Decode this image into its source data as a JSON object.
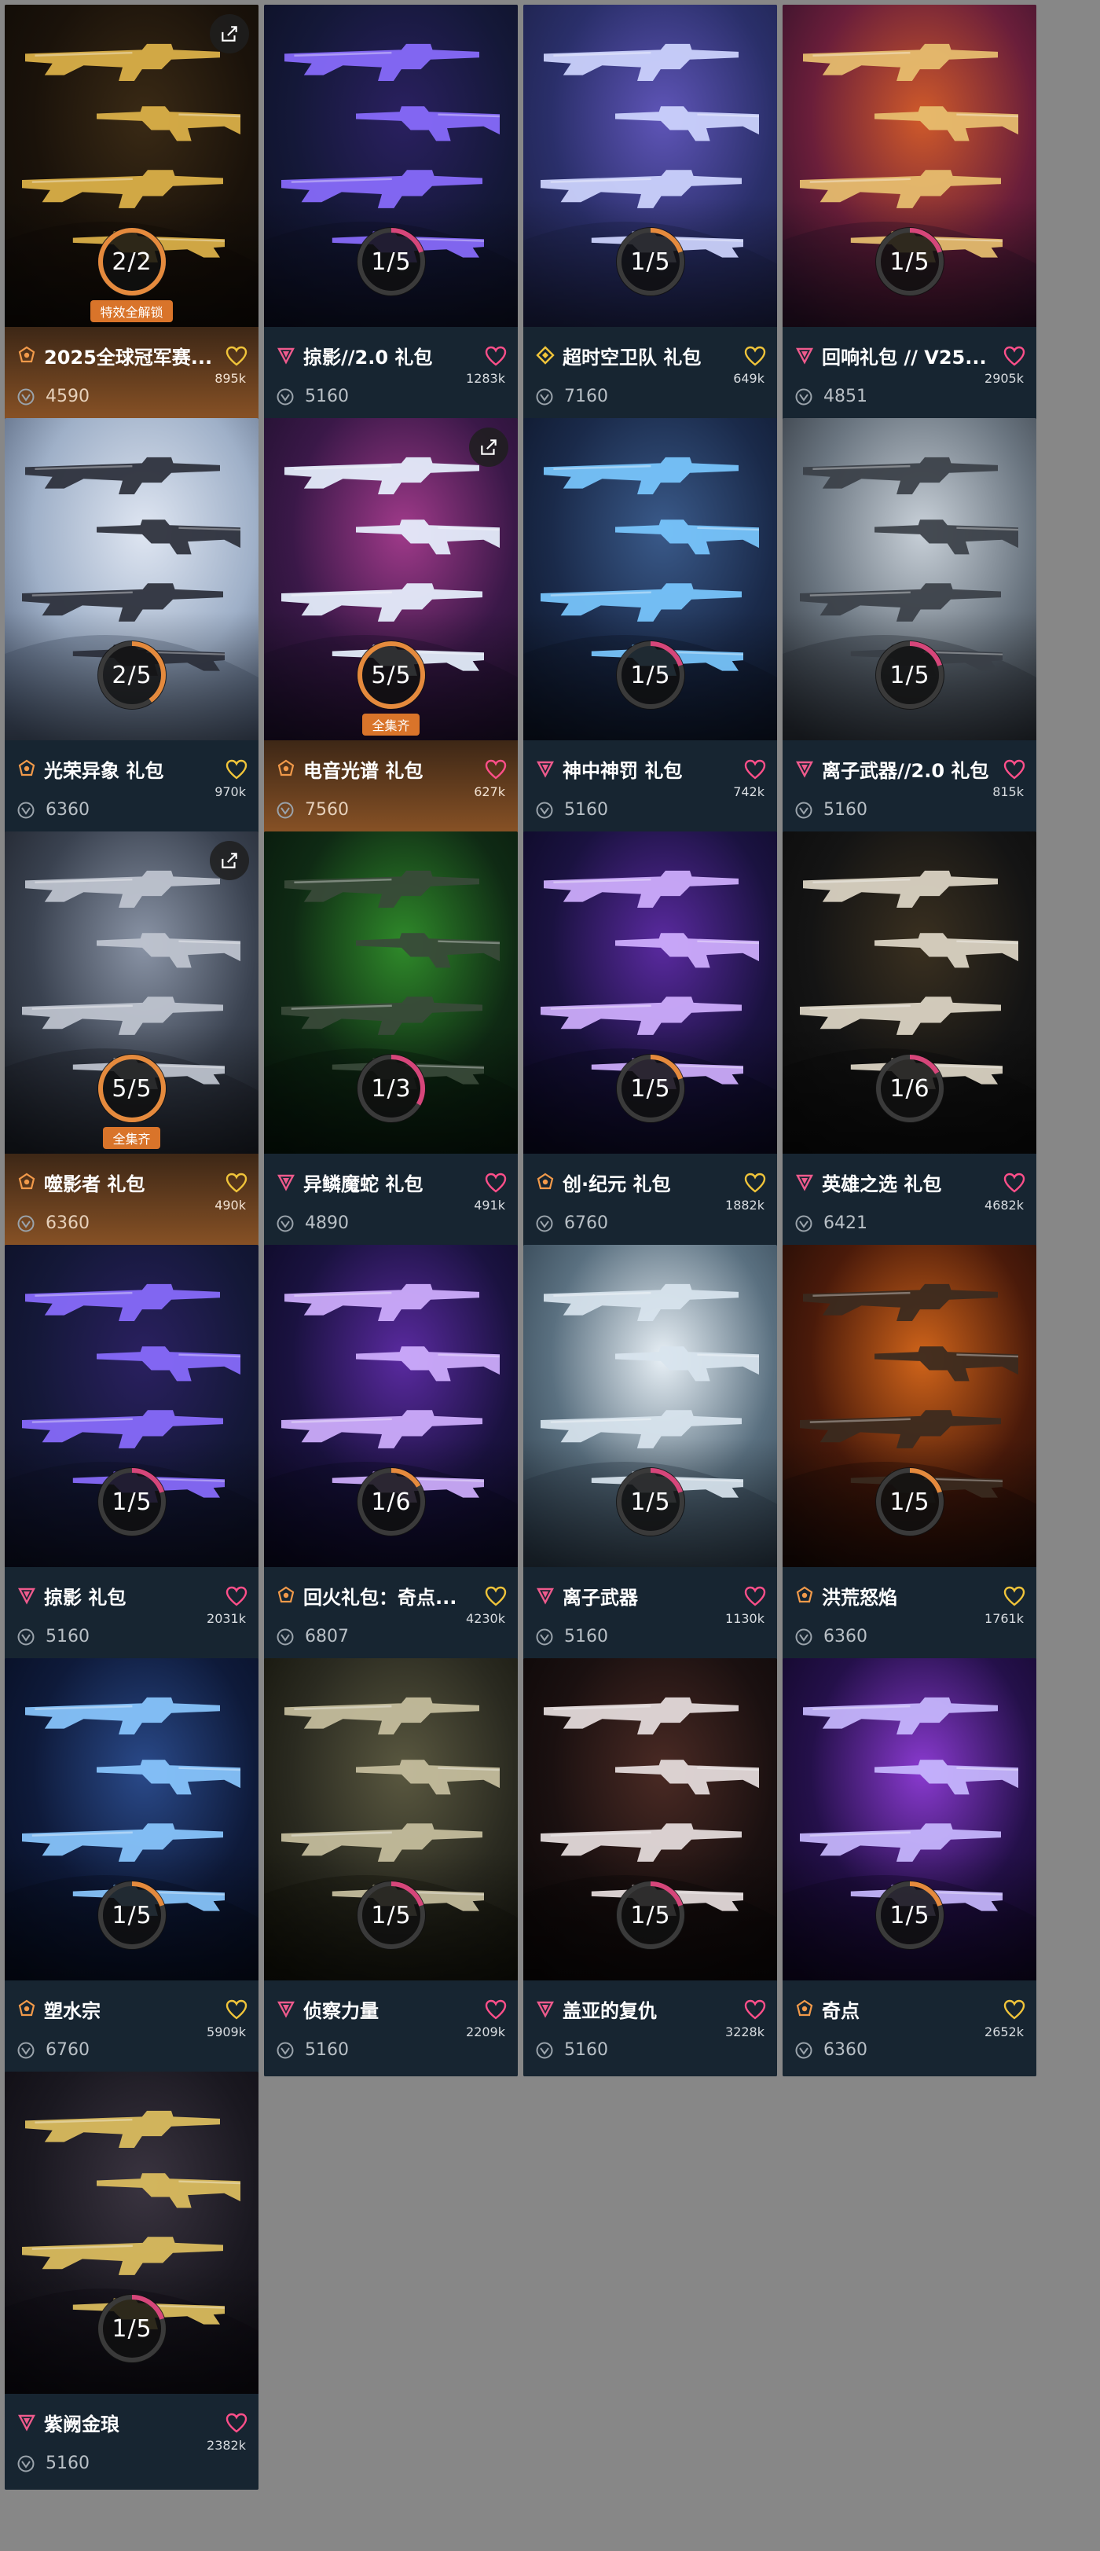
{
  "colors": {
    "page_bg": "#878787",
    "card_bg": "#172531",
    "gold_footer": "#8a5326",
    "ring_track": "#3a3a3a",
    "ring_orange": "#e58a3d",
    "ring_pink": "#d6467a",
    "heart_pink": "#ff4f8a",
    "heart_gold": "#f0c43a"
  },
  "cards": [
    {
      "name": "2025全球冠军赛...",
      "price": "4590",
      "likes": "895k",
      "progress": "2/2",
      "have": 2,
      "total": 2,
      "tier": "ultra",
      "style": "gold",
      "badge": "特效全解锁",
      "share": true,
      "theme": "gold",
      "heart": "gold"
    },
    {
      "name": "掠影//2.0 礼包",
      "price": "5160",
      "likes": "1283k",
      "progress": "1/5",
      "have": 1,
      "total": 5,
      "tier": "exclusive",
      "style": "plain",
      "badge": "",
      "share": false,
      "theme": "violet",
      "heart": "pink"
    },
    {
      "name": "超时空卫队 礼包",
      "price": "7160",
      "likes": "649k",
      "progress": "1/5",
      "have": 1,
      "total": 5,
      "tier": "premium",
      "style": "plain",
      "badge": "",
      "share": false,
      "theme": "space",
      "heart": "gold"
    },
    {
      "name": "回响礼包 // V25...",
      "price": "4851",
      "likes": "2905k",
      "progress": "1/5",
      "have": 1,
      "total": 5,
      "tier": "exclusive",
      "style": "plain",
      "badge": "",
      "share": false,
      "theme": "sunset",
      "heart": "pink"
    },
    {
      "name": "光荣异象 礼包",
      "price": "6360",
      "likes": "970k",
      "progress": "2/5",
      "have": 2,
      "total": 5,
      "tier": "ultra",
      "style": "plain",
      "badge": "",
      "share": false,
      "theme": "ice",
      "heart": "gold"
    },
    {
      "name": "电音光谱 礼包",
      "price": "7560",
      "likes": "627k",
      "progress": "5/5",
      "have": 5,
      "total": 5,
      "tier": "ultra",
      "style": "gold",
      "badge": "全集齐",
      "share": true,
      "theme": "neon",
      "heart": "pink"
    },
    {
      "name": "神中神罚 礼包",
      "price": "5160",
      "likes": "742k",
      "progress": "1/5",
      "have": 1,
      "total": 5,
      "tier": "exclusive",
      "style": "plain",
      "badge": "",
      "share": false,
      "theme": "storm",
      "heart": "pink"
    },
    {
      "name": "离子武器//2.0 礼包",
      "price": "5160",
      "likes": "815k",
      "progress": "1/5",
      "have": 1,
      "total": 5,
      "tier": "exclusive",
      "style": "plain",
      "badge": "",
      "share": false,
      "theme": "silver",
      "heart": "pink"
    },
    {
      "name": "噬影者 礼包",
      "price": "6360",
      "likes": "490k",
      "progress": "5/5",
      "have": 5,
      "total": 5,
      "tier": "ultra",
      "style": "gold",
      "badge": "全集齐",
      "share": true,
      "theme": "grey",
      "heart": "gold"
    },
    {
      "name": "异鳞魔蛇 礼包",
      "price": "4890",
      "likes": "491k",
      "progress": "1/3",
      "have": 1,
      "total": 3,
      "tier": "exclusive",
      "style": "plain",
      "badge": "",
      "share": false,
      "theme": "green",
      "heart": "pink"
    },
    {
      "name": "创·纪元 礼包",
      "price": "6760",
      "likes": "1882k",
      "progress": "1/5",
      "have": 1,
      "total": 5,
      "tier": "ultra",
      "style": "plain",
      "badge": "",
      "share": false,
      "theme": "purple",
      "heart": "gold"
    },
    {
      "name": "英雄之选 礼包",
      "price": "6421",
      "likes": "4682k",
      "progress": "1/6",
      "have": 1,
      "total": 6,
      "tier": "exclusive",
      "style": "plain",
      "badge": "",
      "share": false,
      "theme": "gilded",
      "heart": "pink"
    },
    {
      "name": "掠影 礼包",
      "price": "5160",
      "likes": "2031k",
      "progress": "1/5",
      "have": 1,
      "total": 5,
      "tier": "exclusive",
      "style": "plain",
      "badge": "",
      "share": false,
      "theme": "violet",
      "heart": "pink"
    },
    {
      "name": "回火礼包：奇点...",
      "price": "6807",
      "likes": "4230k",
      "progress": "1/6",
      "have": 1,
      "total": 6,
      "tier": "ultra",
      "style": "plain",
      "badge": "",
      "share": false,
      "theme": "purple",
      "heart": "gold"
    },
    {
      "name": "离子武器",
      "price": "5160",
      "likes": "1130k",
      "progress": "1/5",
      "have": 1,
      "total": 5,
      "tier": "exclusive",
      "style": "plain",
      "badge": "",
      "share": false,
      "theme": "silver2",
      "heart": "pink"
    },
    {
      "name": "洪荒怒焰",
      "price": "6360",
      "likes": "1761k",
      "progress": "1/5",
      "have": 1,
      "total": 5,
      "tier": "ultra",
      "style": "plain",
      "badge": "",
      "share": false,
      "theme": "fire",
      "heart": "gold"
    },
    {
      "name": "塑水宗",
      "price": "6760",
      "likes": "5909k",
      "progress": "1/5",
      "have": 1,
      "total": 5,
      "tier": "ultra",
      "style": "plain",
      "badge": "",
      "share": false,
      "theme": "water",
      "heart": "gold"
    },
    {
      "name": "侦察力量",
      "price": "5160",
      "likes": "2209k",
      "progress": "1/5",
      "have": 1,
      "total": 5,
      "tier": "exclusive",
      "style": "plain",
      "badge": "",
      "share": false,
      "theme": "military",
      "heart": "pink"
    },
    {
      "name": "盖亚的复仇",
      "price": "5160",
      "likes": "3228k",
      "progress": "1/5",
      "have": 1,
      "total": 5,
      "tier": "exclusive",
      "style": "plain",
      "badge": "",
      "share": false,
      "theme": "gaia",
      "heart": "pink"
    },
    {
      "name": "奇点",
      "price": "6360",
      "likes": "2652k",
      "progress": "1/5",
      "have": 1,
      "total": 5,
      "tier": "ultra",
      "style": "plain",
      "badge": "",
      "share": false,
      "theme": "vortex",
      "heart": "gold"
    },
    {
      "name": "紫阙金琅",
      "price": "5160",
      "likes": "2382k",
      "progress": "1/5",
      "have": 1,
      "total": 5,
      "tier": "exclusive",
      "style": "plain",
      "badge": "",
      "share": false,
      "theme": "blackgold",
      "heart": "pink"
    }
  ]
}
